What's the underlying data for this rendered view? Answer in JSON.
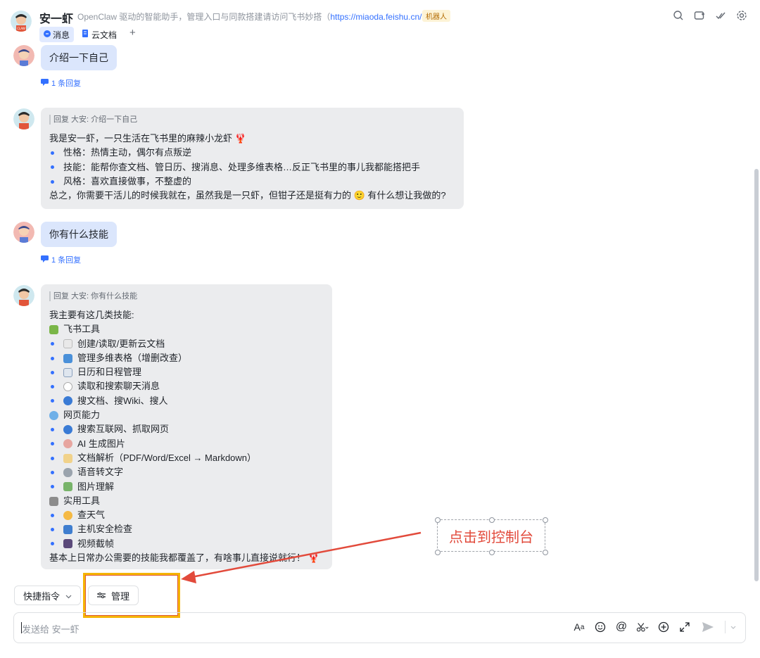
{
  "header": {
    "title": "安一虾",
    "description": "OpenClaw 驱动的智能助手，管理入口与同款搭建请访问飞书妙搭（",
    "link": "https://miaoda.feishu.cn/bot",
    "desc_end": "）",
    "badge": "机器人",
    "tabs": [
      {
        "label": "消息"
      },
      {
        "label": "云文档"
      }
    ],
    "tab_add": "+"
  },
  "messages": {
    "m1": {
      "text": "介绍一下自己",
      "replies": "1 条回复"
    },
    "r1": {
      "quote": "回复 大安: 介绍一下自己",
      "intro": "我是安一虾，一只生活在飞书里的麻辣小龙虾 🦞",
      "items": [
        "性格：热情主动，偶尔有点叛逆",
        "技能：能帮你查文档、管日历、搜消息、处理多维表格…反正飞书里的事儿我都能搭把手",
        "风格：喜欢直接做事，不整虚的"
      ],
      "outro": "总之，你需要干活儿的时候我就在，虽然我是一只虾，但钳子还是挺有力的 🙂 有什么想让我做的?"
    },
    "m2": {
      "text": "你有什么技能",
      "replies": "1 条回复"
    },
    "r2": {
      "quote": "回复 大安: 你有什么技能",
      "intro": "我主要有这几类技能:",
      "sec1": "飞书工具",
      "s1": [
        "创建/读取/更新云文档",
        "管理多维表格（增删改查）",
        "日历和日程管理",
        "读取和搜索聊天消息",
        "搜文档、搜Wiki、搜人"
      ],
      "sec2": "网页能力",
      "s2": [
        "搜索互联网、抓取网页",
        "AI 生成图片",
        "文档解析（PDF/Word/Excel → Markdown）",
        "语音转文字",
        "图片理解"
      ],
      "sec3": "实用工具",
      "s3": [
        "查天气",
        "主机安全检查",
        "视频截帧"
      ],
      "outro": "基本上日常办公需要的技能我都覆盖了，有啥事儿直接说就行！ 🦞"
    }
  },
  "quick": {
    "commands": "快捷指令",
    "manage": "管理"
  },
  "input": {
    "placeholder": "发送给 安一虾"
  },
  "annotation": {
    "callout": "点击到控制台"
  },
  "colors": {
    "accent": "#3370ff",
    "bubble_me": "#dbe6fc",
    "bubble_bot": "#ebecee",
    "annotation": "#e24a3b",
    "highlight": "#f5b400"
  }
}
